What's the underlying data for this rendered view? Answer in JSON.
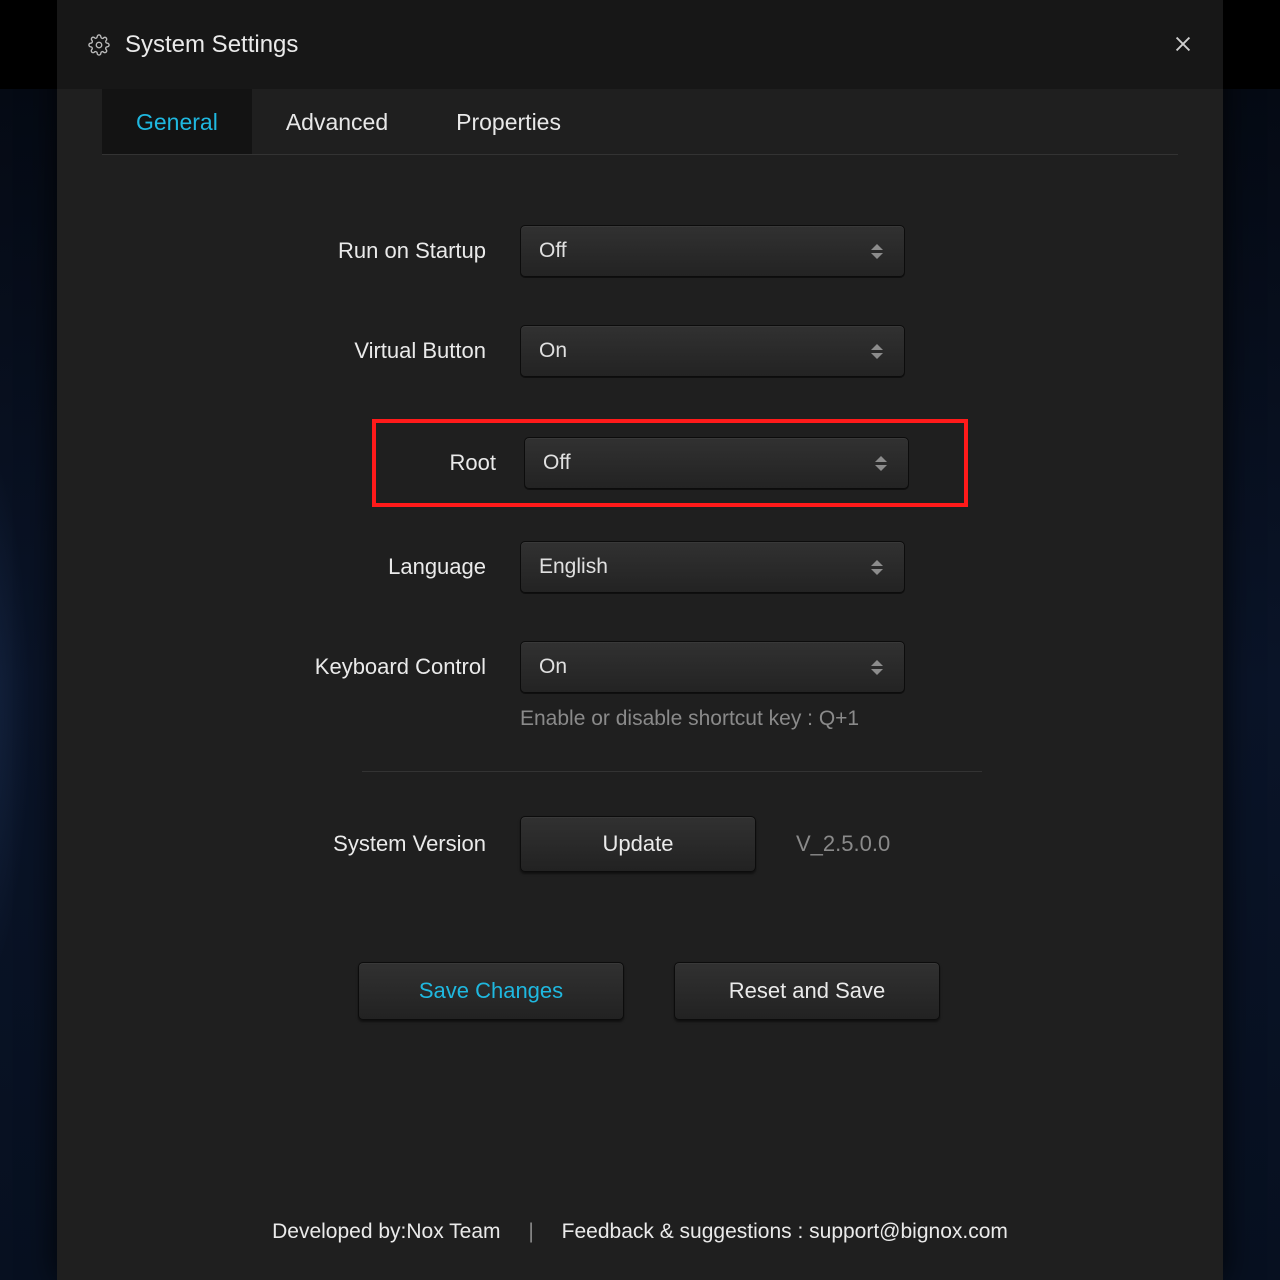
{
  "window": {
    "title": "System Settings"
  },
  "tabs": {
    "general": "General",
    "advanced": "Advanced",
    "properties": "Properties"
  },
  "settings": {
    "run_on_startup": {
      "label": "Run on Startup",
      "value": "Off"
    },
    "virtual_button": {
      "label": "Virtual Button",
      "value": "On"
    },
    "root": {
      "label": "Root",
      "value": "Off"
    },
    "language": {
      "label": "Language",
      "value": "English"
    },
    "keyboard_ctrl": {
      "label": "Keyboard Control",
      "value": "On"
    },
    "keyboard_hint": "Enable or disable shortcut key : Q+1"
  },
  "system": {
    "label": "System Version",
    "update_label": "Update",
    "version": "V_2.5.0.0"
  },
  "actions": {
    "save": "Save Changes",
    "reset": "Reset and Save"
  },
  "footer": {
    "developed": "Developed by:Nox Team",
    "feedback": "Feedback & suggestions : support@bignox.com"
  }
}
